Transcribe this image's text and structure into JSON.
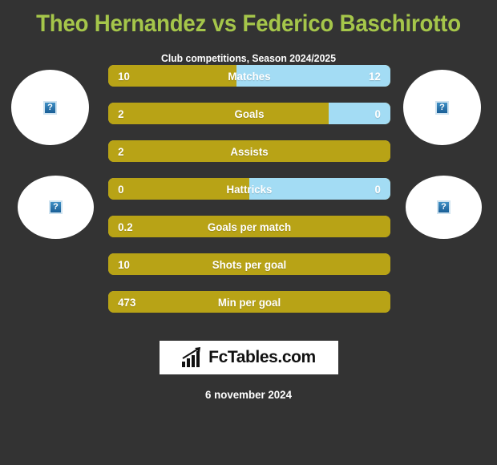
{
  "header": {
    "title": "Theo Hernandez vs Federico Baschirotto",
    "subtitle": "Club competitions, Season 2024/2025",
    "title_color": "#a5c64a"
  },
  "colors": {
    "background": "#333333",
    "left_player_bar": "#b8a316",
    "right_player_bar": "#a3dcf4",
    "text": "#ffffff"
  },
  "avatars": [
    {
      "position": "left-top",
      "icon": "broken-image-icon",
      "glyph": "?"
    },
    {
      "position": "left-bottom",
      "icon": "broken-image-icon",
      "glyph": "?"
    },
    {
      "position": "right-top",
      "icon": "broken-image-icon",
      "glyph": "?"
    },
    {
      "position": "right-bottom",
      "icon": "broken-image-icon",
      "glyph": "?"
    }
  ],
  "chart_data": {
    "type": "bar",
    "title": "Theo Hernandez vs Federico Baschirotto",
    "subtitle": "Club competitions, Season 2024/2025",
    "orientation": "horizontal-diverging",
    "series": [
      {
        "name": "Theo Hernandez",
        "color": "#b8a316"
      },
      {
        "name": "Federico Baschirotto",
        "color": "#a3dcf4"
      }
    ],
    "categories": [
      "Matches",
      "Goals",
      "Assists",
      "Hattricks",
      "Goals per match",
      "Shots per goal",
      "Min per goal"
    ],
    "rows": [
      {
        "label": "Matches",
        "left": "10",
        "right": "12",
        "left_pct": 45.5,
        "right_pct": 54.5
      },
      {
        "label": "Goals",
        "left": "2",
        "right": "0",
        "left_pct": 78.0,
        "right_pct": 22.0
      },
      {
        "label": "Assists",
        "left": "2",
        "right": "",
        "left_pct": 100,
        "right_pct": 0
      },
      {
        "label": "Hattricks",
        "left": "0",
        "right": "0",
        "left_pct": 50.0,
        "right_pct": 50.0
      },
      {
        "label": "Goals per match",
        "left": "0.2",
        "right": "",
        "left_pct": 100,
        "right_pct": 0
      },
      {
        "label": "Shots per goal",
        "left": "10",
        "right": "",
        "left_pct": 100,
        "right_pct": 0
      },
      {
        "label": "Min per goal",
        "left": "473",
        "right": "",
        "left_pct": 100,
        "right_pct": 0
      }
    ]
  },
  "footer": {
    "logo_text": "FcTables.com",
    "logo_icon": "bar-chart-growth-icon",
    "date": "6 november 2024"
  }
}
